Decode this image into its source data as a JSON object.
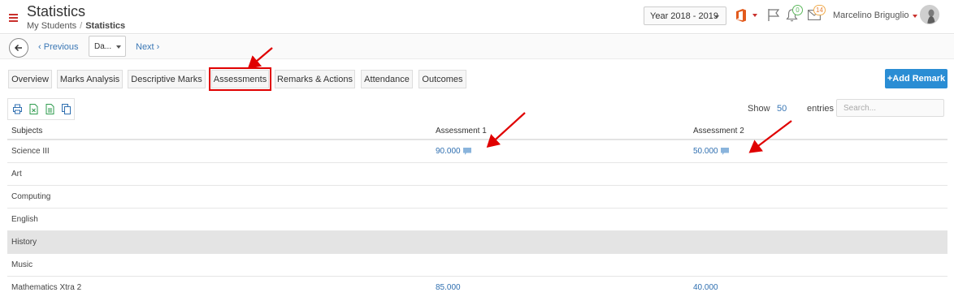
{
  "header": {
    "title": "Statistics",
    "breadcrumb": [
      "My Students",
      "Statistics"
    ],
    "breadcrumb_separator": "/",
    "year_select": "Year 2018 - 2019",
    "bell_count": "0",
    "mail_count": "14",
    "user_name": "Marcelino Briguglio"
  },
  "subbar": {
    "previous": "Previous",
    "date_select": "Da...",
    "next": "Next"
  },
  "tabs": [
    {
      "label": "Overview"
    },
    {
      "label": "Marks Analysis"
    },
    {
      "label": "Descriptive Marks"
    },
    {
      "label": "Assessments"
    },
    {
      "label": "Remarks & Actions"
    },
    {
      "label": "Attendance"
    },
    {
      "label": "Outcomes"
    }
  ],
  "add_remark": "+Add Remark",
  "table_controls": {
    "show_label": "Show",
    "show_value": "50",
    "entries_label": "entries",
    "search_placeholder": "Search..."
  },
  "table": {
    "headers": [
      "Subjects",
      "Assessment 1",
      "Assessment 2"
    ],
    "rows": [
      {
        "subject": "Science III",
        "a1": "90.000",
        "a2": "50.000"
      },
      {
        "subject": "Art",
        "a1": "",
        "a2": ""
      },
      {
        "subject": "Computing",
        "a1": "",
        "a2": ""
      },
      {
        "subject": "English",
        "a1": "",
        "a2": ""
      },
      {
        "subject": "History",
        "a1": "",
        "a2": ""
      },
      {
        "subject": "Music",
        "a1": "",
        "a2": ""
      },
      {
        "subject": "Mathematics Xtra 2",
        "a1": "85.000",
        "a2": "40.000"
      }
    ]
  },
  "colors": {
    "accent_red": "#e00000",
    "link_blue": "#2f6fb0",
    "button_blue": "#2a8dd4",
    "highlight_row": "#e4e4e4"
  }
}
